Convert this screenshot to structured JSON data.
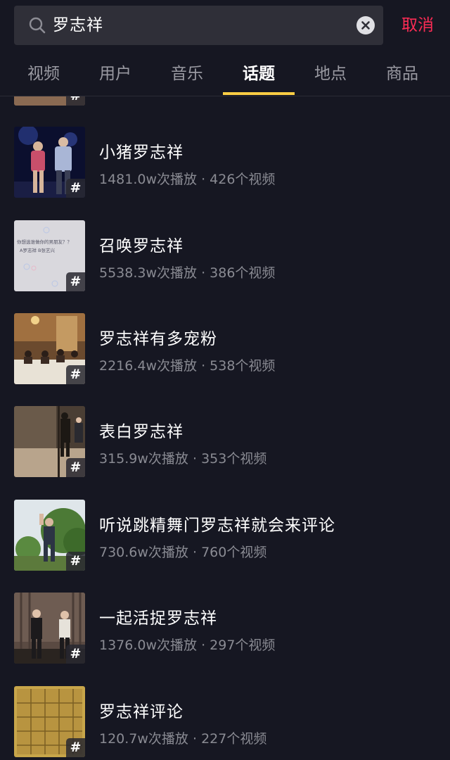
{
  "search": {
    "query": "罗志祥",
    "cancel_label": "取消"
  },
  "tabs": [
    {
      "label": "视频"
    },
    {
      "label": "用户"
    },
    {
      "label": "音乐"
    },
    {
      "label": "话题",
      "active": true
    },
    {
      "label": "地点"
    },
    {
      "label": "商品"
    }
  ],
  "results": [
    {
      "title": "小猪罗志祥",
      "plays": "1481.0w次播放",
      "videos": "426个视频"
    },
    {
      "title": "召唤罗志祥",
      "plays": "5538.3w次播放",
      "videos": "386个视频"
    },
    {
      "title": "罗志祥有多宠粉",
      "plays": "2216.4w次播放",
      "videos": "538个视频"
    },
    {
      "title": "表白罗志祥",
      "plays": "315.9w次播放",
      "videos": "353个视频"
    },
    {
      "title": "听说跳精舞门罗志祥就会来评论",
      "plays": "730.6w次播放",
      "videos": "760个视频"
    },
    {
      "title": "一起活捉罗志祥",
      "plays": "1376.0w次播放",
      "videos": "297个视频"
    },
    {
      "title": "罗志祥评论",
      "plays": "120.7w次播放",
      "videos": "227个视频"
    }
  ],
  "thumb_texts": {
    "summon_line1": "你想选谁做你的男朋友？？",
    "summon_line2": "A罗志祥  B张艺兴"
  },
  "hash_symbol": "#",
  "meta_separator": " · ",
  "colors": {
    "background": "#161722",
    "accent_cancel": "#fe2c55",
    "tab_underline": "#facd44",
    "meta_text": "#8a8b93"
  }
}
